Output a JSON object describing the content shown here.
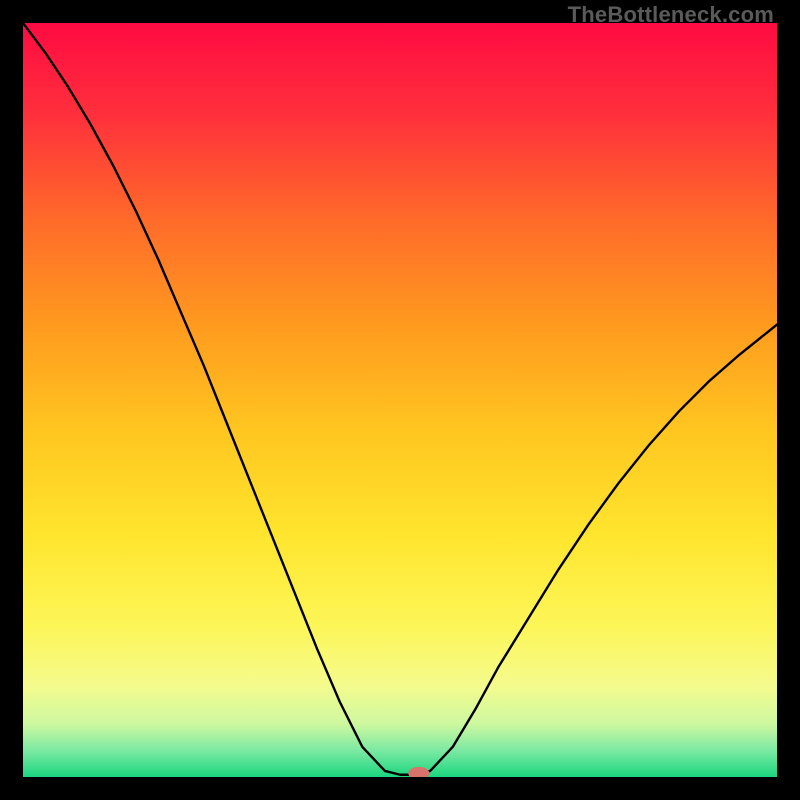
{
  "watermark": "TheBottleneck.com",
  "chart_data": {
    "type": "line",
    "title": "",
    "xlabel": "",
    "ylabel": "",
    "xlim": [
      0,
      100
    ],
    "ylim": [
      0,
      100
    ],
    "background_gradient": {
      "stops": [
        {
          "offset": 0.0,
          "color": "#ff0b42"
        },
        {
          "offset": 0.12,
          "color": "#ff2f3c"
        },
        {
          "offset": 0.26,
          "color": "#ff6a2a"
        },
        {
          "offset": 0.4,
          "color": "#ff9a1f"
        },
        {
          "offset": 0.54,
          "color": "#ffc620"
        },
        {
          "offset": 0.68,
          "color": "#ffe52e"
        },
        {
          "offset": 0.8,
          "color": "#fdf658"
        },
        {
          "offset": 0.88,
          "color": "#f4fb8e"
        },
        {
          "offset": 0.93,
          "color": "#cdf8a0"
        },
        {
          "offset": 0.965,
          "color": "#7be9a3"
        },
        {
          "offset": 1.0,
          "color": "#1bd67f"
        }
      ]
    },
    "series": [
      {
        "name": "bottleneck-curve",
        "color": "#000000",
        "x": [
          0.0,
          3.0,
          6.0,
          9.0,
          12.0,
          15.0,
          18.0,
          21.0,
          24.0,
          27.0,
          30.0,
          33.0,
          36.0,
          39.0,
          42.0,
          45.0,
          48.0,
          50.0,
          52.0,
          54.0,
          57.0,
          60.0,
          63.0,
          67.0,
          71.0,
          75.0,
          79.0,
          83.0,
          87.0,
          91.0,
          95.0,
          100.0
        ],
        "y": [
          100.0,
          96.0,
          91.5,
          86.5,
          81.0,
          75.0,
          68.5,
          61.5,
          54.5,
          47.0,
          39.5,
          32.0,
          24.5,
          17.0,
          10.0,
          4.0,
          0.8,
          0.3,
          0.3,
          0.8,
          4.0,
          9.0,
          14.5,
          21.0,
          27.5,
          33.5,
          39.0,
          44.0,
          48.5,
          52.5,
          56.0,
          60.0
        ]
      }
    ],
    "marker": {
      "name": "min-marker",
      "x": 52.5,
      "y": 0.5,
      "rx": 1.4,
      "ry": 0.85,
      "color": "#d9746b"
    }
  }
}
